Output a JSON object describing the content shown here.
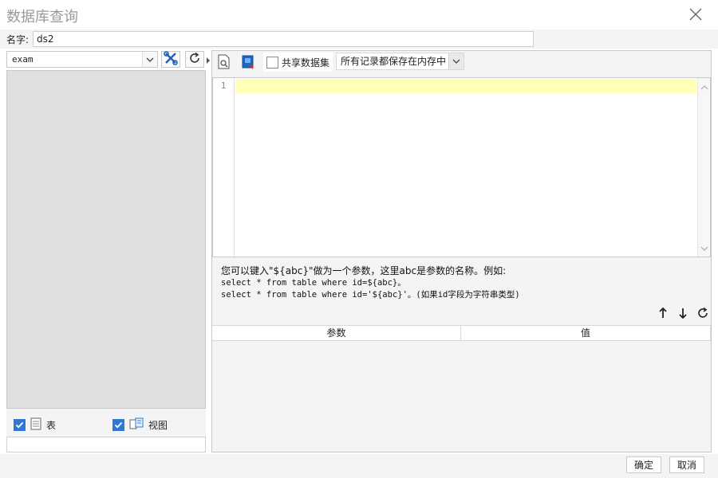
{
  "window": {
    "title": "数据库查询"
  },
  "name_field": {
    "label": "名字:",
    "value": "ds2"
  },
  "left": {
    "database": "exam",
    "checkboxes": [
      {
        "label": "表",
        "checked": true
      },
      {
        "label": "视图",
        "checked": true
      }
    ]
  },
  "toolbar": {
    "share_label": "共享数据集",
    "share_checked": false,
    "memory_option": "所有记录都保存在内存中"
  },
  "editor": {
    "line_number": "1"
  },
  "hint": {
    "line1": "您可以键入\"${abc}\"做为一个参数，这里abc是参数的名称。例如:",
    "line2": "select * from table where id=${abc}。",
    "line3": "select * from table where id='${abc}'。(如果id字段为字符串类型)"
  },
  "params": {
    "col_param": "参数",
    "col_value": "值"
  },
  "footer": {
    "ok": "确定",
    "cancel": "取消"
  },
  "colors": {
    "accent": "#2f78d6",
    "current_line": "#ffffb8",
    "panel_gray": "#dfdfe1"
  }
}
